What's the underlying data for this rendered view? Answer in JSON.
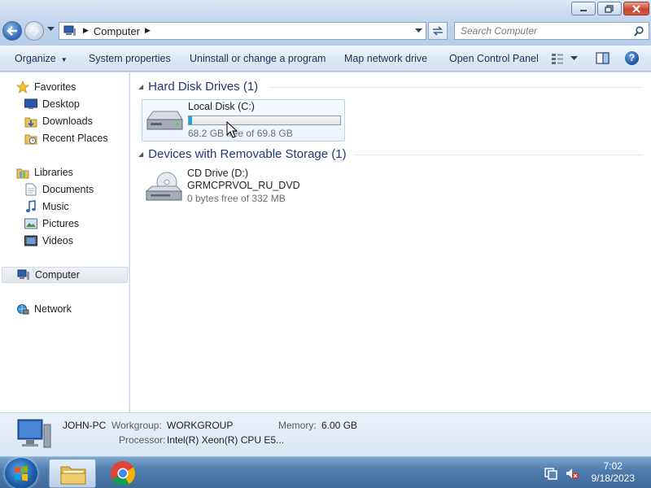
{
  "address": {
    "crumb": "Computer"
  },
  "search": {
    "placeholder": "Search Computer"
  },
  "toolbar": {
    "organize": "Organize",
    "system_properties": "System properties",
    "uninstall": "Uninstall or change a program",
    "map_drive": "Map network drive",
    "control_panel": "Open Control Panel"
  },
  "nav": {
    "favorites": "Favorites",
    "desktop": "Desktop",
    "downloads": "Downloads",
    "recent_places": "Recent Places",
    "libraries": "Libraries",
    "documents": "Documents",
    "music": "Music",
    "pictures": "Pictures",
    "videos": "Videos",
    "computer": "Computer",
    "network": "Network"
  },
  "groups": {
    "hdd_title": "Hard Disk Drives (1)",
    "removable_title": "Devices with Removable Storage (1)"
  },
  "drives": {
    "c": {
      "name": "Local Disk (C:)",
      "free": "68.2 GB free of 69.8 GB",
      "used_fraction": 0.023
    },
    "d": {
      "name": "CD Drive (D:)",
      "label": "GRMCPRVOL_RU_DVD",
      "free": "0 bytes free of 332 MB"
    }
  },
  "details": {
    "computer_name": "JOHN-PC",
    "workgroup_label": "Workgroup:",
    "workgroup": "WORKGROUP",
    "memory_label": "Memory:",
    "memory": "6.00 GB",
    "processor_label": "Processor:",
    "processor": "Intel(R) Xeon(R) CPU E5..."
  },
  "clock": {
    "time": "7:02",
    "date": "9/18/2023"
  },
  "colors": {
    "progress_fill": "#26a0da",
    "group_title": "#1e3878",
    "taskbar": "#4f7dae"
  }
}
